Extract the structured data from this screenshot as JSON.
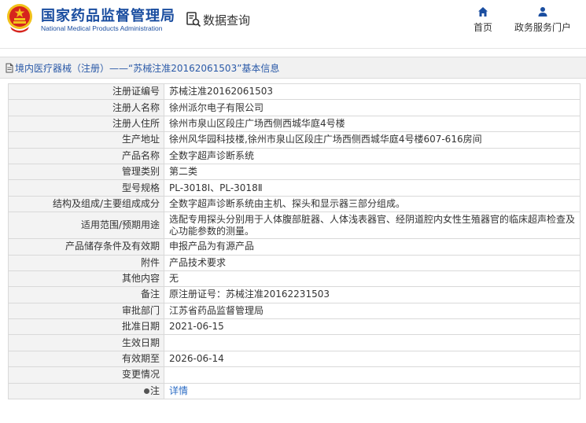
{
  "header": {
    "title_cn": "国家药品监督管理局",
    "title_en": "National Medical Products Administration",
    "query_label": "数据查询",
    "nav": [
      {
        "label": "首页",
        "icon": "home-icon"
      },
      {
        "label": "政务服务门户",
        "icon": "user-icon"
      }
    ]
  },
  "breadcrumb": {
    "text": "境内医疗器械（注册）——“苏械注准20162061503”基本信息"
  },
  "details": {
    "rows": [
      {
        "key": "注册证编号",
        "value": "苏械注准20162061503"
      },
      {
        "key": "注册人名称",
        "value": "徐州派尔电子有限公司"
      },
      {
        "key": "注册人住所",
        "value": "徐州市泉山区段庄广场西侧西城华庭4号楼"
      },
      {
        "key": "生产地址",
        "value": "徐州风华园科技楼,徐州市泉山区段庄广场西侧西城华庭4号楼607-616房间"
      },
      {
        "key": "产品名称",
        "value": "全数字超声诊断系统"
      },
      {
        "key": "管理类别",
        "value": "第二类"
      },
      {
        "key": "型号规格",
        "value": "PL-3018Ⅰ、PL-3018Ⅱ"
      },
      {
        "key": "结构及组成/主要组成成分",
        "value": "全数字超声诊断系统由主机、探头和显示器三部分组成。"
      },
      {
        "key": "适用范围/预期用途",
        "value": "选配专用探头分别用于人体腹部脏器、人体浅表器官、经阴道腔内女性生殖器官的临床超声检查及心功能参数的测量。"
      },
      {
        "key": "产品储存条件及有效期",
        "value": "申报产品为有源产品"
      },
      {
        "key": "附件",
        "value": "产品技术要求"
      },
      {
        "key": "其他内容",
        "value": "无"
      },
      {
        "key": "备注",
        "value": "原注册证号：苏械注准20162231503"
      },
      {
        "key": "审批部门",
        "value": "江苏省药品监督管理局"
      },
      {
        "key": "批准日期",
        "value": "2021-06-15"
      },
      {
        "key": "生效日期",
        "value": ""
      },
      {
        "key": "有效期至",
        "value": "2026-06-14"
      },
      {
        "key": "变更情况",
        "value": ""
      }
    ],
    "note_key": "注",
    "note_link": "详情"
  },
  "colors": {
    "brand_blue": "#1b4ea0",
    "link_blue": "#2b6cc4",
    "emblem_red": "#d6241d",
    "emblem_gold": "#f2c21b"
  }
}
